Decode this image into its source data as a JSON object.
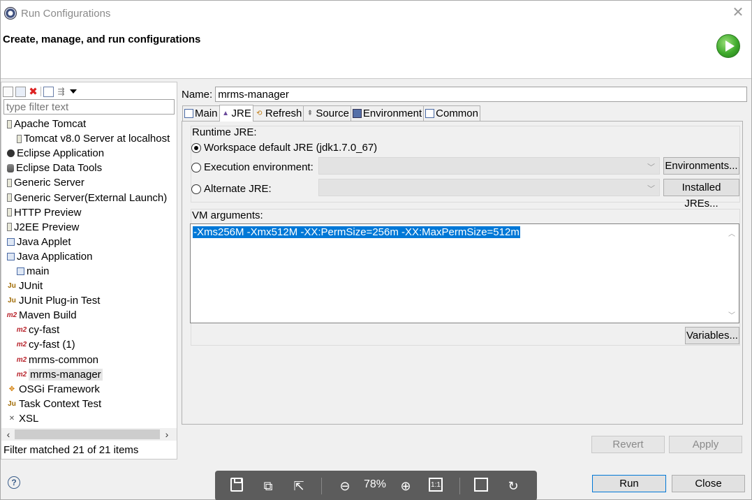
{
  "window": {
    "title": "Run Configurations",
    "close_glyph": "✕"
  },
  "banner": {
    "heading": "Create, manage, and run configurations",
    "icon": "run-icon"
  },
  "left": {
    "filter_placeholder": "type filter text",
    "tree": [
      {
        "label": "Apache Tomcat",
        "level": 0,
        "icon": "tomcat-icon"
      },
      {
        "label": "Tomcat v8.0 Server at localhost",
        "level": 1,
        "icon": "tomcat-icon"
      },
      {
        "label": "Eclipse Application",
        "level": 0,
        "icon": "eclipse-icon"
      },
      {
        "label": "Eclipse Data Tools",
        "level": 0,
        "icon": "database-icon"
      },
      {
        "label": "Generic Server",
        "level": 0,
        "icon": "server-icon"
      },
      {
        "label": "Generic Server(External Launch)",
        "level": 0,
        "icon": "server-icon"
      },
      {
        "label": "HTTP Preview",
        "level": 0,
        "icon": "server-icon"
      },
      {
        "label": "J2EE Preview",
        "level": 0,
        "icon": "server-icon"
      },
      {
        "label": "Java Applet",
        "level": 0,
        "icon": "applet-icon"
      },
      {
        "label": "Java Application",
        "level": 0,
        "icon": "java-app-icon"
      },
      {
        "label": "main",
        "level": 1,
        "icon": "java-app-icon"
      },
      {
        "label": "JUnit",
        "level": 0,
        "icon": "junit-icon"
      },
      {
        "label": "JUnit Plug-in Test",
        "level": 0,
        "icon": "junit-plugin-icon"
      },
      {
        "label": "Maven Build",
        "level": 0,
        "icon": "maven-icon"
      },
      {
        "label": "cy-fast",
        "level": 1,
        "icon": "maven-icon"
      },
      {
        "label": "cy-fast (1)",
        "level": 1,
        "icon": "maven-icon"
      },
      {
        "label": "mrms-common",
        "level": 1,
        "icon": "maven-icon"
      },
      {
        "label": "mrms-manager",
        "level": 1,
        "icon": "maven-icon",
        "selected": true
      },
      {
        "label": "OSGi Framework",
        "level": 0,
        "icon": "osgi-icon"
      },
      {
        "label": "Task Context Test",
        "level": 0,
        "icon": "task-icon"
      },
      {
        "label": "XSL",
        "level": 0,
        "icon": "xsl-icon"
      }
    ],
    "status": "Filter matched 21 of 21 items"
  },
  "right": {
    "name_label": "Name:",
    "name_value": "mrms-manager",
    "tabs": [
      {
        "label": "Main",
        "icon": "main-tab-icon"
      },
      {
        "label": "JRE",
        "icon": "jre-tab-icon",
        "active": true
      },
      {
        "label": "Refresh",
        "icon": "refresh-tab-icon"
      },
      {
        "label": "Source",
        "icon": "source-tab-icon"
      },
      {
        "label": "Environment",
        "icon": "environment-tab-icon"
      },
      {
        "label": "Common",
        "icon": "common-tab-icon"
      }
    ],
    "runtime": {
      "title": "Runtime JRE:",
      "opt_workspace": "Workspace default JRE (jdk1.7.0_67)",
      "opt_execution": "Execution environment:",
      "opt_alternate": "Alternate JRE:",
      "environments_btn": "Environments...",
      "installed_btn": "Installed JREs..."
    },
    "vm": {
      "title": "VM arguments:",
      "value": "-Xms256M -Xmx512M -XX:PermSize=256m -XX:MaxPermSize=512m",
      "variables_btn": "Variables..."
    },
    "revert_btn": "Revert",
    "apply_btn": "Apply"
  },
  "footer": {
    "run_btn": "Run",
    "close_btn": "Close",
    "viewer_zoom": "78%",
    "one_to_one": "1:1"
  }
}
